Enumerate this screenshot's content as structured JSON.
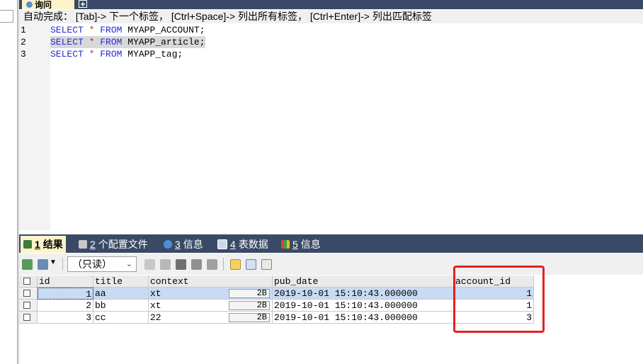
{
  "query_tab": {
    "label": "询问"
  },
  "hint": {
    "text": "自动完成： [Tab]-> 下一个标签， [Ctrl+Space]-> 列出所有标签， [Ctrl+Enter]-> 列出匹配标签"
  },
  "editor": {
    "lines": [
      {
        "num": "1",
        "kw1": "SELECT",
        "op": "*",
        "kw2": "FROM",
        "table": "MYAPP_ACCOUNT;"
      },
      {
        "num": "2",
        "kw1": "SELECT",
        "op": "*",
        "kw2": "FROM",
        "table": "MYAPP_article;"
      },
      {
        "num": "3",
        "kw1": "SELECT",
        "op": "*",
        "kw2": "FROM",
        "table": "MYAPP_tag;"
      }
    ]
  },
  "result_tabs": [
    {
      "num": "1",
      "label": "结果"
    },
    {
      "num": "2",
      "label": "个配置文件"
    },
    {
      "num": "3",
      "label": "信息"
    },
    {
      "num": "4",
      "label": "表数据"
    },
    {
      "num": "5",
      "label": "信息"
    }
  ],
  "toolbar": {
    "readonly_label": "（只读）"
  },
  "grid": {
    "columns": [
      "id",
      "title",
      "context",
      "pub_date",
      "account_id"
    ],
    "rows": [
      {
        "id": "1",
        "title": "aa",
        "context": "xt",
        "blob": "2B",
        "pub_date": "2019-10-01 15:10:43.000000",
        "account_id": "1"
      },
      {
        "id": "2",
        "title": "bb",
        "context": "xt",
        "blob": "2B",
        "pub_date": "2019-10-01 15:10:43.000000",
        "account_id": "1"
      },
      {
        "id": "3",
        "title": "cc",
        "context": "22",
        "blob": "2B",
        "pub_date": "2019-10-01 15:10:43.000000",
        "account_id": "3"
      }
    ]
  },
  "colors": {
    "tabbar": "#3a4a66",
    "active_tab": "#fdf3c8",
    "highlight": "#e52020",
    "selected_row": "#c9daf3"
  }
}
